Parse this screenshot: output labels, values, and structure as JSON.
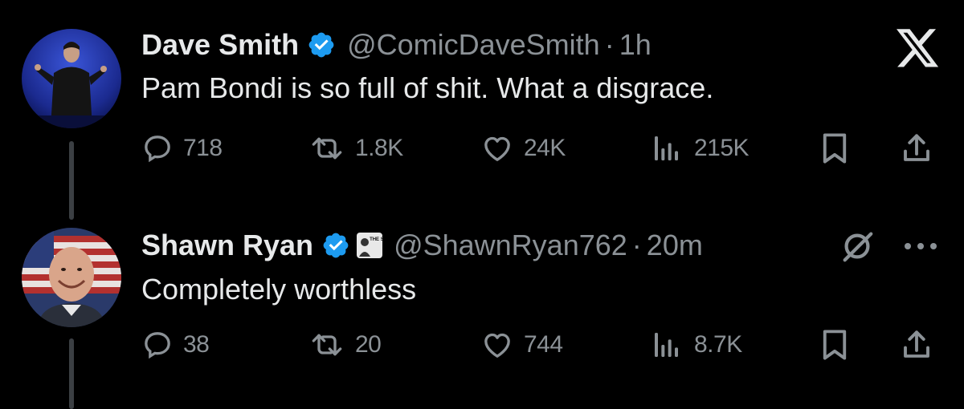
{
  "tweets": [
    {
      "author": "Dave Smith",
      "handle": "@ComicDaveSmith",
      "separator": "·",
      "time": "1h",
      "text": "Pam Bondi is so full of shit. What a disgrace.",
      "stats": {
        "replies": "718",
        "reposts": "1.8K",
        "likes": "24K",
        "views": "215K"
      },
      "top_right_icon": "x-logo-icon"
    },
    {
      "author": "Shawn Ryan",
      "handle": "@ShawnRyan762",
      "separator": "·",
      "time": "20m",
      "text": "Completely worthless",
      "affiliate_badge": "THE SHOW",
      "stats": {
        "replies": "38",
        "reposts": "20",
        "likes": "744",
        "views": "8.7K"
      },
      "top_right_icons": [
        "grok-icon",
        "more-icon"
      ]
    }
  ],
  "colors": {
    "background": "#000000",
    "text": "#e7e9ea",
    "muted": "#8b9196",
    "verified": "#1d9bf0",
    "thread_line": "#3b3f43"
  }
}
